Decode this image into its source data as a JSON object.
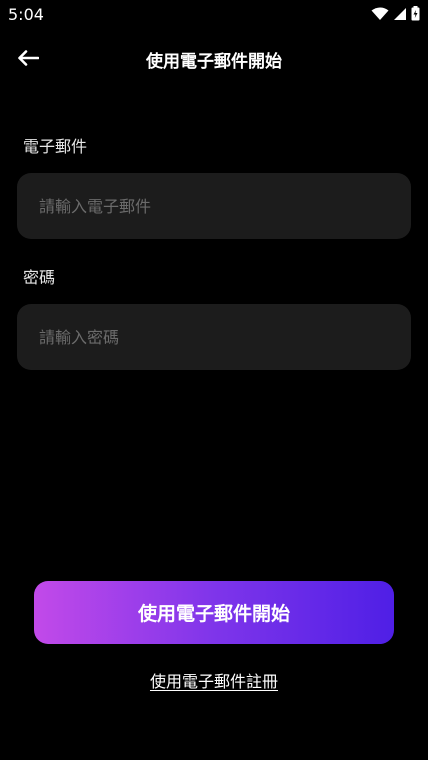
{
  "status_bar": {
    "time": "5:04",
    "icons": [
      "wifi-icon",
      "signal-icon",
      "battery-icon"
    ]
  },
  "header": {
    "title": "使用電子郵件開始",
    "back_icon": "arrow-left-icon"
  },
  "form": {
    "email": {
      "label": "電子郵件",
      "placeholder": "請輸入電子郵件",
      "value": ""
    },
    "password": {
      "label": "密碼",
      "placeholder": "請輸入密碼",
      "value": ""
    }
  },
  "actions": {
    "primary_label": "使用電子郵件開始",
    "register_label": "使用電子郵件註冊"
  },
  "colors": {
    "background": "#000000",
    "input_bg": "#1c1c1c",
    "gradient_start": "#c24ae9",
    "gradient_end": "#4f1fe6"
  }
}
